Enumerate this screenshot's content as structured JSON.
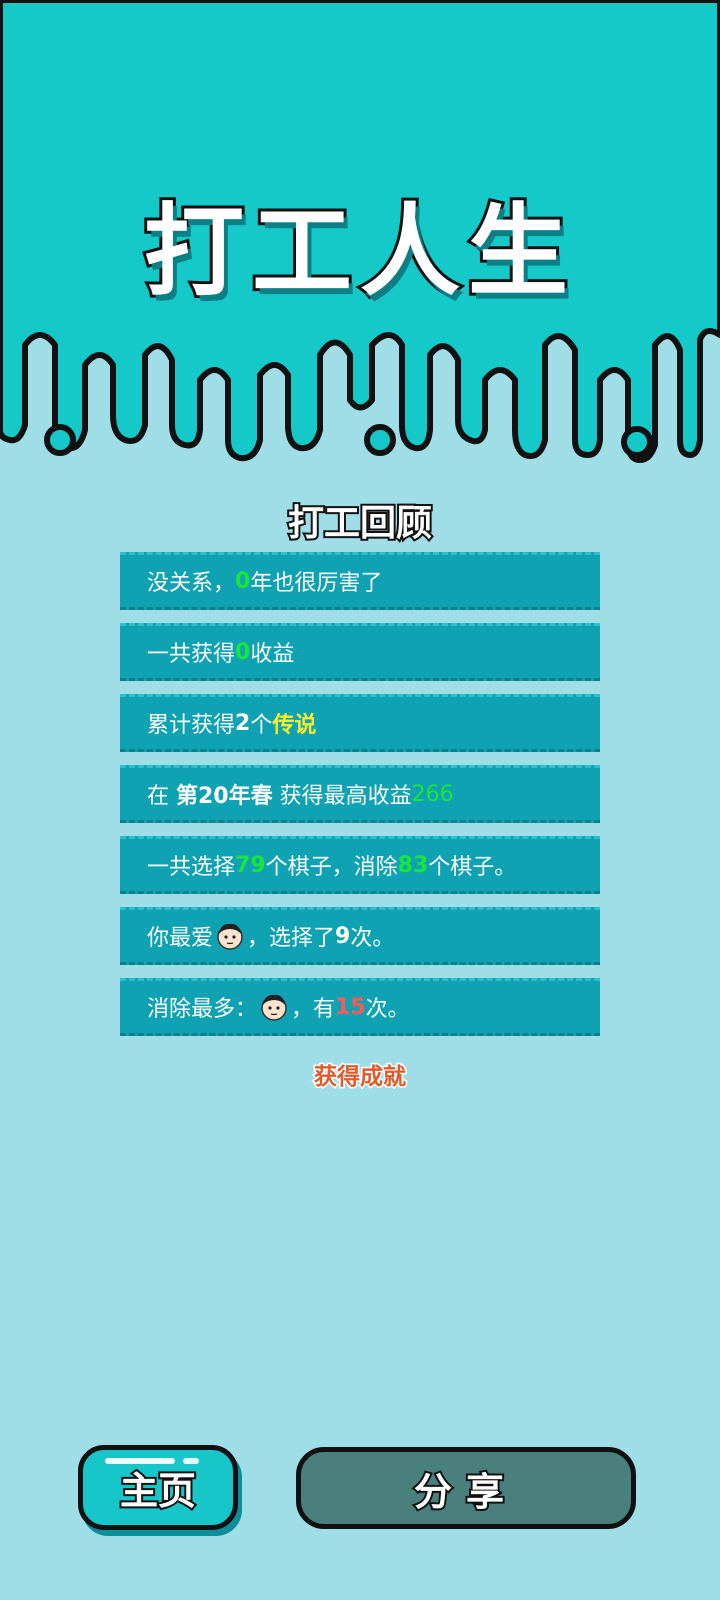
{
  "title": "打工人生",
  "section_title": "打工回顾",
  "colors": {
    "top_band": "#15c9c9",
    "background": "#9fdee6",
    "row": "#0ea2b2",
    "highlight_green": "#19e63a",
    "highlight_yellow": "#f8ef2c",
    "highlight_red": "#ff5a5a"
  },
  "rows": {
    "r1": {
      "pre": "没关系，",
      "value": "0",
      "post": "年也很厉害了"
    },
    "r2": {
      "pre": "一共获得",
      "value": "0",
      "post": "收益"
    },
    "r3": {
      "pre": "累计获得",
      "count": "2",
      "mid": "个",
      "value": "传说"
    },
    "r4": {
      "pre": "在 ",
      "season": "第20年春",
      "mid": " 获得最高收益",
      "value": "266"
    },
    "r5": {
      "pre": "一共选择",
      "chosen": "79",
      "mid": "个棋子，消除",
      "removed": "83",
      "post": "个棋子。"
    },
    "r6": {
      "pre": "你最爱",
      "icon": "worker-face-icon",
      "mid": "，选择了",
      "value": "9",
      "post": "次。"
    },
    "r7": {
      "pre": "消除最多：",
      "icon": "worker-face-icon",
      "mid": "，有",
      "value": "15",
      "post": "次。"
    }
  },
  "achievement": "获得成就",
  "buttons": {
    "home": "主页",
    "share": "分享"
  }
}
